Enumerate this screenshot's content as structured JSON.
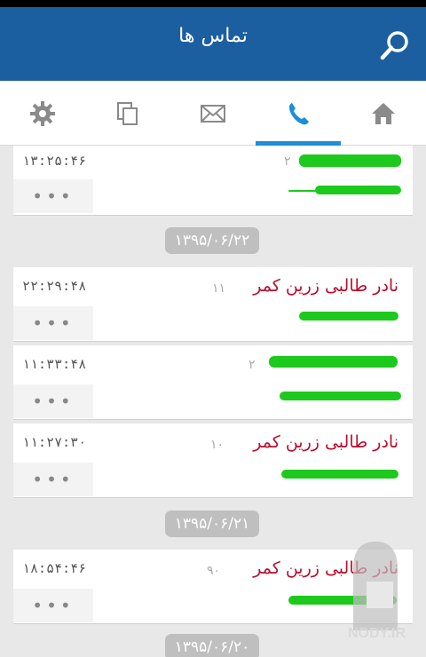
{
  "appbar": {
    "title": "تماس ها",
    "search_icon": "search-icon"
  },
  "tabs": [
    {
      "name": "settings",
      "icon": "gear-icon",
      "active": false
    },
    {
      "name": "copy",
      "icon": "copy-icon",
      "active": false
    },
    {
      "name": "messages",
      "icon": "envelope-icon",
      "active": false
    },
    {
      "name": "calls",
      "icon": "phone-icon",
      "active": true
    },
    {
      "name": "home",
      "icon": "home-icon",
      "active": false
    }
  ],
  "colors": {
    "appbar": "#1c5fa0",
    "active_tab": "#1c8fd9",
    "name": "#b80f2f",
    "scribble": "#1cc91c"
  },
  "entries": [
    {
      "time": "۱۳:۲۵:۴۶",
      "name": "",
      "count": "۲",
      "number": "",
      "more": "•••"
    },
    {
      "time": "۲۲:۲۹:۴۸",
      "name": "نادر طالبی زرین کمر",
      "count": "۱۱",
      "number": "",
      "more": "•••"
    },
    {
      "time": "۱۱:۳۳:۴۸",
      "name": "",
      "count": "۲",
      "number": "",
      "more": "•••"
    },
    {
      "time": "۱۱:۲۷:۳۰",
      "name": "نادر طالبی زرین کمر",
      "count": "۱۰",
      "number": "",
      "more": "•••"
    },
    {
      "time": "۱۸:۵۴:۴۶",
      "name": "نادر طالبی زرین کمر",
      "count": "۹۰",
      "number": "",
      "more": "•••"
    }
  ],
  "dates": [
    "۱۳۹۵/۰۶/۲۲",
    "۱۳۹۵/۰۶/۲۱",
    "۱۳۹۵/۰۶/۲۰"
  ],
  "watermark": {
    "text": "NODY.IR"
  }
}
